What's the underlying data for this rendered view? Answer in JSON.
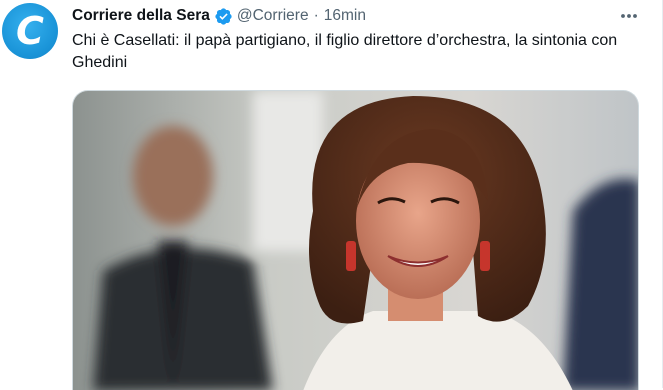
{
  "tweet": {
    "display_name": "Corriere della Sera",
    "handle": "@Corriere",
    "separator": "·",
    "time": "16min",
    "text": "Chi è Casellati: il papà partigiano, il figlio direttore d’orchestra, la sintonia con Ghedini",
    "avatar_letter": "C",
    "verified": true
  },
  "icons": {
    "avatar": "corriere-logo",
    "verified": "verified-badge-icon",
    "more": "more-horizontal-icon",
    "media": "photo"
  },
  "colors": {
    "brand": "#1da1f2",
    "avatar_bg": "#1a94d8",
    "verified": "#1d9bf0",
    "text": "#0f1419",
    "secondary": "#536471"
  }
}
